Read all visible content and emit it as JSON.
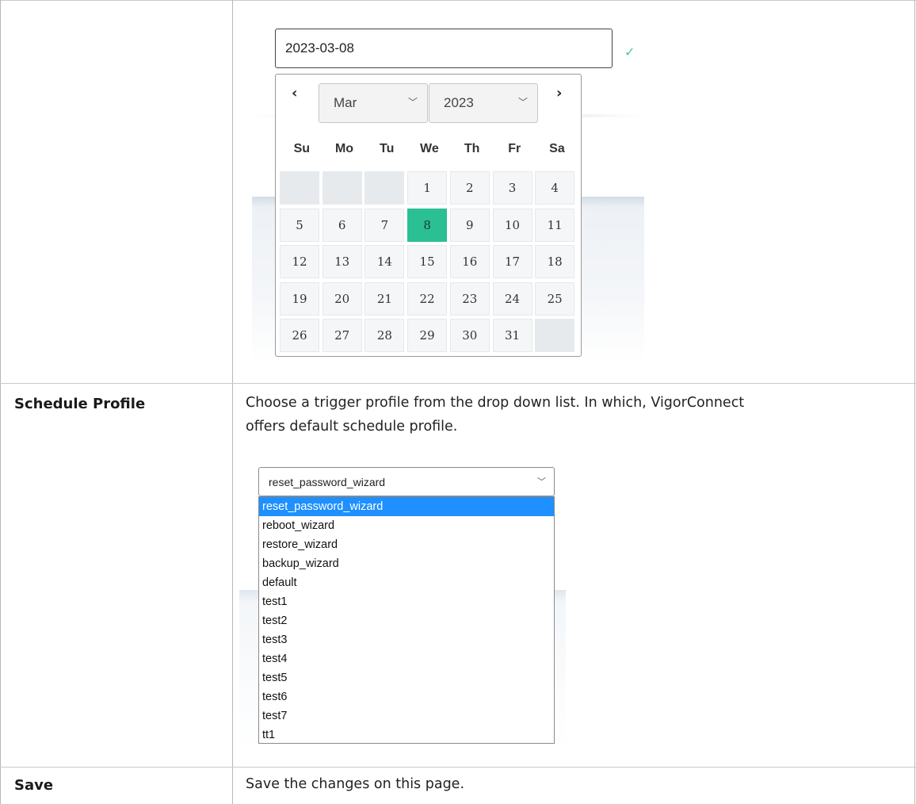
{
  "date_picker": {
    "value": "2023-03-08",
    "valid_icon": "check-icon",
    "prev_icon": "chevron-left-icon",
    "next_icon": "chevron-right-icon",
    "month": "Mar",
    "year": "2023",
    "weekdays": [
      "Su",
      "Mo",
      "Tu",
      "We",
      "Th",
      "Fr",
      "Sa"
    ],
    "selected_day": "8",
    "selected_color": "#2bbf94",
    "weeks": [
      [
        "",
        "",
        "",
        "1",
        "2",
        "3",
        "4"
      ],
      [
        "5",
        "6",
        "7",
        "8",
        "9",
        "10",
        "11"
      ],
      [
        "12",
        "13",
        "14",
        "15",
        "16",
        "17",
        "18"
      ],
      [
        "19",
        "20",
        "21",
        "22",
        "23",
        "24",
        "25"
      ],
      [
        "26",
        "27",
        "28",
        "29",
        "30",
        "31",
        ""
      ]
    ]
  },
  "rows": [
    {
      "label": "Schedule Profile",
      "description_line1": "Choose a trigger profile from the drop down list. In which, VigorConnect",
      "description_line2": "offers default schedule profile."
    },
    {
      "label": "Save",
      "description_line1": "Save the changes on this page."
    }
  ],
  "schedule_dropdown": {
    "selected": "reset_password_wizard",
    "highlight_color": "#1e90ff",
    "options": [
      "reset_password_wizard",
      "reboot_wizard",
      "restore_wizard",
      "backup_wizard",
      "default",
      "test1",
      "test2",
      "test3",
      "test4",
      "test5",
      "test6",
      "test7",
      "tt1"
    ]
  }
}
